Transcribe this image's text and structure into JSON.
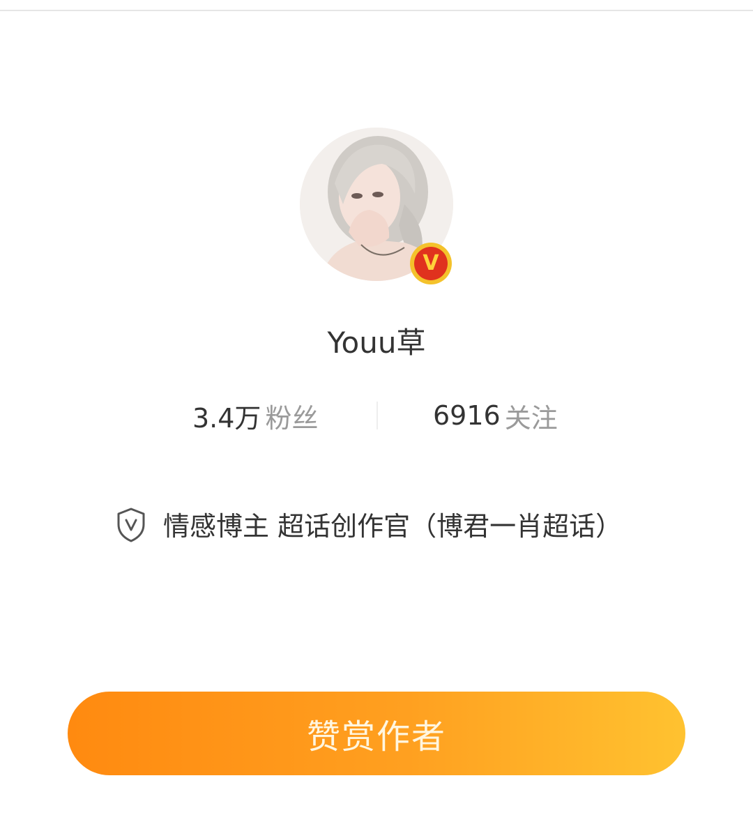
{
  "profile": {
    "username": "Youu草",
    "verified_badge": "V",
    "avatar_icon": "avatar-portrait"
  },
  "stats": {
    "fans_count": "3.4万",
    "fans_label": "粉丝",
    "follow_count": "6916",
    "follow_label": "关注"
  },
  "bio": {
    "icon": "shield-v-icon",
    "text": "情感博主 超话创作官（博君一肖超话）"
  },
  "action": {
    "reward_label": "赞赏作者"
  },
  "colors": {
    "accent_start": "#ff8a10",
    "accent_end": "#ffc230",
    "badge_red": "#e0321e",
    "badge_gold": "#f4c22b"
  }
}
